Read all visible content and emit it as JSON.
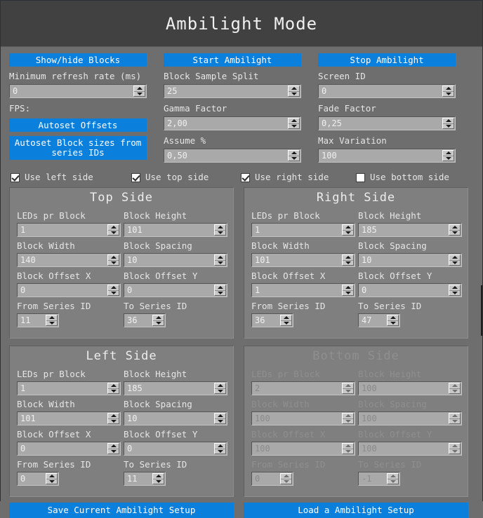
{
  "window": {
    "title": "Ambilight Mode"
  },
  "toolbar": {
    "show_hide_blocks": "Show/hide Blocks",
    "start_ambilight": "Start Ambilight",
    "stop_ambilight": "Stop Ambilight",
    "autoset_offsets": "Autoset Offsets",
    "autoset_block_sizes": "Autoset Block sizes from series IDs"
  },
  "settings": {
    "min_refresh_rate": {
      "label": "Minimum refresh rate (ms)",
      "value": "0"
    },
    "fps": {
      "label": "FPS:",
      "value": ""
    },
    "block_sample_split": {
      "label": "Block Sample Split",
      "value": "25"
    },
    "gamma_factor": {
      "label": "Gamma Factor",
      "value": "2,00"
    },
    "assume_pct": {
      "label": "Assume %",
      "value": "0,50"
    },
    "screen_id": {
      "label": "Screen ID",
      "value": "0"
    },
    "fade_factor": {
      "label": "Fade Factor",
      "value": "0,25"
    },
    "max_variation": {
      "label": "Max Variation",
      "value": "100"
    }
  },
  "checkboxes": [
    {
      "label": "Use left side",
      "checked": true
    },
    {
      "label": "Use top side",
      "checked": true
    },
    {
      "label": "Use right side",
      "checked": true
    },
    {
      "label": "Use bottom side",
      "checked": false
    }
  ],
  "field_labels": {
    "leds_pr_block": "LEDs pr Block",
    "block_height": "Block Height",
    "block_width": "Block Width",
    "block_spacing": "Block Spacing",
    "block_offset_x": "Block Offset X",
    "block_offset_y": "Block Offset Y",
    "from_series_id": "From Series ID",
    "to_series_id": "To Series ID"
  },
  "panels": {
    "top": {
      "title": "Top Side",
      "enabled": true,
      "leds_pr_block": "1",
      "block_height": "101",
      "block_width": "140",
      "block_spacing": "10",
      "block_offset_x": "0",
      "block_offset_y": "0",
      "from_series_id": "11",
      "to_series_id": "36"
    },
    "right": {
      "title": "Right Side",
      "enabled": true,
      "leds_pr_block": "1",
      "block_height": "185",
      "block_width": "101",
      "block_spacing": "10",
      "block_offset_x": "1",
      "block_offset_y": "0",
      "from_series_id": "36",
      "to_series_id": "47"
    },
    "left": {
      "title": "Left Side",
      "enabled": true,
      "leds_pr_block": "1",
      "block_height": "185",
      "block_width": "101",
      "block_spacing": "10",
      "block_offset_x": "0",
      "block_offset_y": "0",
      "from_series_id": "0",
      "to_series_id": "11"
    },
    "bottom": {
      "title": "Bottom Side",
      "enabled": false,
      "leds_pr_block": "2",
      "block_height": "100",
      "block_width": "100",
      "block_spacing": "100",
      "block_offset_x": "100",
      "block_offset_y": "100",
      "from_series_id": "0",
      "to_series_id": "-1"
    }
  },
  "footer": {
    "save_setup": "Save Current Ambilight Setup",
    "load_setup": "Load a Ambilight Setup"
  },
  "colors": {
    "accent_blue": "#0b7fdc",
    "window_bg": "#6e6e6e",
    "titlebar_bg": "#414141",
    "panel_bg": "#7f7f7f",
    "field_bg": "#a9a9a9"
  }
}
